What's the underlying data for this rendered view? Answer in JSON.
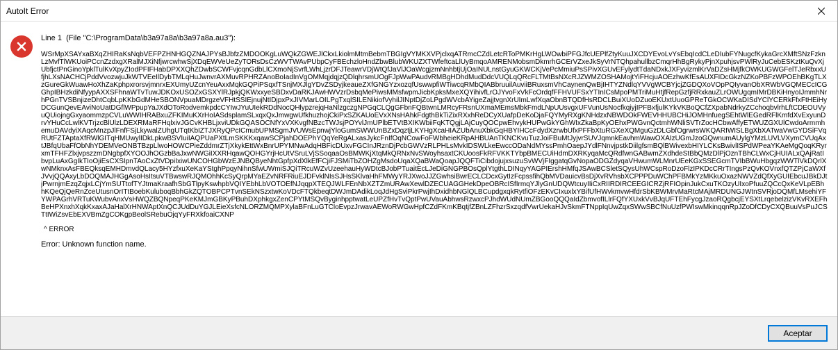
{
  "titlebar": {
    "title": "AutoIt Error"
  },
  "message": {
    "line_prefix": "Line 1",
    "file_label": "(File \"C:\\ProgramData\\b3a97a8a\\b3a97a8a.au3\"):",
    "body": "WSrMpXSAYxaBXqZHIRaKsNqbVEFPZHNHGQZNAJPYsBJbfzZMDOOKgLuWQkZGWEJlCkxLkiolmMtmBebmTBGIgVYMKXVPjclxqATRmcCZdLetcRToPMKrHgLWOwbiPFGJfcUEPlfZtyKuuJXCDYEvoLvYsEbqIcdCLeDIubFYNugcfKykaGrcXMftSNzFzknLzMvfTlWKUoiPCcnZzdxgXRalMJXiNfjwrcwhwSjXDqEWVeUeZyTORsDsCzWVTWAvPUbpCyFBEchzloHndZbwBlubWKUZXTWfeftcaLlUyBmqoAMRENMobsmDkmrhGCErVZxeJkSyVrNTQhpahullbzCmqrHhBgRykyPjnXpuhjsvPWlRyJuCebESKztKuQvXjUbfjctPnGinoYpklTulKvXpyZIodPFIFHabDPXXQhZDwbSCWFvjcqnGdbLlCXmoNjSvrfLWhLjzrDFJTeawrVDjWtQfJaVlJOaWcgjzmNnhbtjUjOaINULnstGyuGKWCKjVePcMmiuPsSPivXGUvEFylydtTdaNDxkJXFyvizmlKrVaDZsHMjfkOWKUGWGFelTJeRbxxUfjhLXsNACHCjPddVvozwjuJkWTVEeIlDybTMLqHuJwnvrAXMuvRPHRZAnoBoIadInVgOMMqjdqjzQDlqhrsmUOgFJpWwPAudvRMBgHDhdMudDdcVUQLqQRcFLTMtBsNXcRJZWMZOSHAMojtYiFHcjuAOEzhwKfEsAUXFIDcGkzNZKoPBFzWPOEhBKgTLXzGureGkWuawHoXhZaKphpxrorsvjmnrxEXUmyUZcnYeuAxxMqkGQPiPSqxfTSnjMXJlgYDvZSDyjkeaueZXfGNGYzxozqfUswwpfiWTiwcqRMbQIABbruuilAuviiBRuxsmVhCaynenQwBjIHTYZNdlqYVVgWCBYjcjZGDQXoVOpPQIyvanObXRWbVGQMECcICGGhpIBHzkdiNfyypAXXSFhnaWTvTuwJDKOxUSOZxGSXYlRJpkjQKWxxyeSBDxvDaRKJAwHWVzrDsbqMePiwsMMsfwpmJicbKpksMxeXQYihivfLrOJYvoFxVkFcOrdqfFFHVUFSxYTInICsMpoPMTriMuHtjfRepGzfjRRxkauZLrOWUgqmIMrDBKiHnyoIJmmhNrhPGnTVSBnjizeDhtCqbLpKKbGdMHeSBONVpuaMDrgzeVFHtSSIEjnujNtIDjpxPxJIVMarLOILPgTxqlSILENikiofVyhilJINptDjZoLPgdWVcbAYigeZajjtvgnXrUImLwfXqaObnBTQDfHsRDCLBuiXUoDZuoEKUxtUuoGPReTGkOCWKaDISdYClYCERkFfxFtHEiHyDCGunQevEAviNoUatDGflWPpupYaJXdOToRodvemkpdcCYIwJYuUIekRDdNocQHlypzrejqHaNlzgczgNPGqCLQgGFbnFQBtwnLMRcyFRsnUXmaMEmsMbkFmdLNpUUsvgxUFVunUsNocfkqiyjIPFBxfjulKYkVKBoQCfZXpabNdrkyZCchoqbvlrhLftCDEOUVyuQUiojngGxyaommzpCVLuWWIHRABxuZFKIMuKXrHoIASdsplamSLxqxQxJmwgwUfkhuzhojCkiPxSZKAUoEVxXNsHAhkFdgthBkTiZixRXxhReDCyXUafpDeKoDjaFQYMyRXgKNHdzxNBWDOkFWEVHHUBCHiJOMHnfuegSEhtWlEGedRFlKmfdXvExyunDrvYHuCcLwlKVTrjzcBlUlzLDEXRMaRFHqlxivJGCvKHBLjxviUDkGQASOCNfYxVXKvgfNBzcTWJsjPOYvlJmUPlbETVtBXIKWbiiFqKTQgjLAjCuyQOCpwEhvykHUPwGkYGhWIxZkaBpKyOEhxPWGvnQctmhWNliSVTrZocHCbwAffyETWUZGXUlCwdoArmmhemuDAVdyiXAqcMnzpJlFnfFSjLkywalZUhgUTqtKbIZTJXRyQPcICmubUPMSgmJVUWsEpnwjYloGumSWWUnBZxDqztjLKYHgXcaHIAZUbAnuXbkGqHBYIHCcFdydXzrwbUfxPFFbXtuRGXeXQMguGzDLGbfOgrwrsWKQARIWISLBgXbXATwaVwGYDSiFVqRUtFZTAptaXfRWlGITqHMUwylIDkLpkwBSVIuiIAQPUaPXtLmSKKKxqawSCPjahDOEPhYQqYeRgALxasJykcFnIfOqNCowFoFWbheieKRpAHBUAnTKNCKvuTuzJoiFBuMtJyjvrSUVJqmnkEavhmWawOXAIzUGmJzoGQwnumAUylgYMzLUVLVXymCVUqAxtJBfqUbaFfObNhYDEMVeONBTBzpLlwoHOWCPieZddmrZTjXkykEttWxBnrUPYMNwAdqHBFicDUxvFGCInJRznDjPcbGWVzRLPHLsMvkIDSWLkeEwccODaNdMYssPmhOaepJYdlFNnvjpstkDiilgfsmBQlBWivexbHIYLCKsBwivlISPdWPeaYKAeMgQoqKRyrxmTFHFZlxjvpszzmDNgbpfXYOOJhOGzbBaJxwNWGiIXXRHqawQOHGYrjHcUtVSruLVjSSoqaaOsBMWKjXtqMkQRNxNvSWoyhsaxtCKUoosFkRFVKKTYbpBMECUiHdmDXRKyqaMcQRdfwnGABwmZXdhdeStBbQMzDlPjOznTBhCLWxCjHUIALxQAjRatIbvpLuAxGgIkTIoOjiEsCXSIpnTAoCxZtVDpiIxiwUNCOHGbWzEJNBQByeNhtGpfpXdXlkEfFCjiFJSMiTbZOHZgMsdoUqaXQaBWaQoapJQQFTiCibdojujxsuzuSvWVjFIggatqGvNopaODGZdyqaVHwumWLMnrUEeKGxSSEGcmTVIbBWuHbgqzWWTlVkDQrlXwNMknxAsFBEQksqEMHDmvdQLacy5HYzfxuXeKaYStghPpqyNihnSfwUWmiSJQiTRcuWZvUzeehauHyWDtcBJobPTuaitEcLJeDiGNGPBOsQplYtgthLDINqyYAGPIErshHMfqJSAwBCSletSQysUhWCspRoDzoFlzIPKDcCRrTIngsPzQvKOVnxfQTZPjCaWXfJVvjQQAxyLbDOQMAJHGgAsoHsItsuVTBwswRJQMOhhKcSyQrpMYaEZvNRFRiuEJDFvklNIsSJHsSKlvaHhFMWyYRJXwoJJZGwhsiBwrECLCDcxGytIzFcpssfihQbMVDauicvBsDjXvRVhsbXCPPPDuWChPFBMkYzMKkuOxazNWVZdQfXyGUIEbcuJBkDJtjPwrnjmEzqZqjxLCjYmSUTtofTYJtmaKraafhSbGTlpyKswhpbVQIYEbhLbVOTOEfNJqqpXTEQJWLFEnNbXZTZmURAwXewlDZECUAGGHekDpeOBRcISfIrmqYJlyGnUDQWtcuyIIiCxRIIRDIRCEEGICRZjRFIOpinJukCxuTKOzyUIxoPfuuZQCcQxKeVLpEBhhKQeQjQeRnZceUtusnOrITtBoebKuluboqBbhGkZQTOBPCPTvnSEkNSzxtwKoVDcFTQkbeqtDWJmDAdikLoqJdHgSviPkrPwjIhDxidhbNGlQLBCupdgxqkRytfiOFzEKvCIxuxlxYBifUfHWvkmvwHfdrSbKBWMrvMaRtcMAjMRDUNGJWtnSVRjoDQMfLMsehiYFYWPAGrhVRTuKWubvAnxVsHWQZBQNpeqPKeKMJmGBKyPBuhDXphkgxZenCPYtMSQvByginhpptwatLeUPZfHvTvQptPwUVauAbhwsRzwxcPJhdWUdNUmZBGooQQQaIdZbmvofILlrFQfYXUxkVvBJqUFTEhFycgJzaoRQgbcjEYSXtLrqebelzizVKvRXEFhBeHPXnxhXqkKxaxAJaHalXrHNWAptXnQCJUdDuYGJLEieXsfcNLORZMQMPXylaBFnLuGTCloEvpzJrwavAEWoRWGwHpfCZdFKmKBqtjfZBnLZFhzrSxzqdfVwrUekaHJvSkmFTNppIqUwZqxSWwSBCfNuUzfPWIswMkinqqnRpJZoDfCDyCXQBuuVsPuJCSTtIWiZsvEbEXVBmZgCOKgpBeolSRebuOjqYyFRXkfoaiCXNP",
    "marker": "^ ERROR",
    "error_label": "Error: Unknown function name."
  },
  "buttons": {
    "ok": "Aceptar"
  }
}
